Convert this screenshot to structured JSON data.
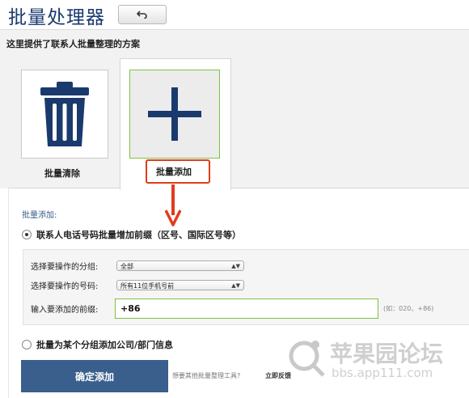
{
  "header": {
    "title": "批量处理器"
  },
  "intro": "这里提供了联系人批量整理的方案",
  "tiles": {
    "clear_label": "批量清除",
    "add_label": "批量添加"
  },
  "section": {
    "title": "批量添加:"
  },
  "options": {
    "prefix_label": "联系人电话号码批量增加前缀（区号、国际区号等）",
    "company_label": "批量为某个分组添加公司/部门信息"
  },
  "form": {
    "group_label": "选择要操作的分组:",
    "group_value": "全部",
    "number_label": "选择要操作的号码:",
    "number_value": "所有11位手机号前",
    "prefix_input_label": "输入要添加的前缀:",
    "prefix_value": "+86",
    "hint": "(如：020、+86)"
  },
  "footer": {
    "confirm_label": "确定添加",
    "question": "想要其他批量整理工具?",
    "feedback": "立即反馈"
  },
  "watermark": {
    "cn": "苹果园论坛",
    "url": "bbs.app111.com"
  },
  "colors": {
    "accent_green": "#7dc242",
    "highlight_red": "#e03c1c",
    "button_blue": "#3a5f8c",
    "icon_navy": "#1a3a6e"
  }
}
